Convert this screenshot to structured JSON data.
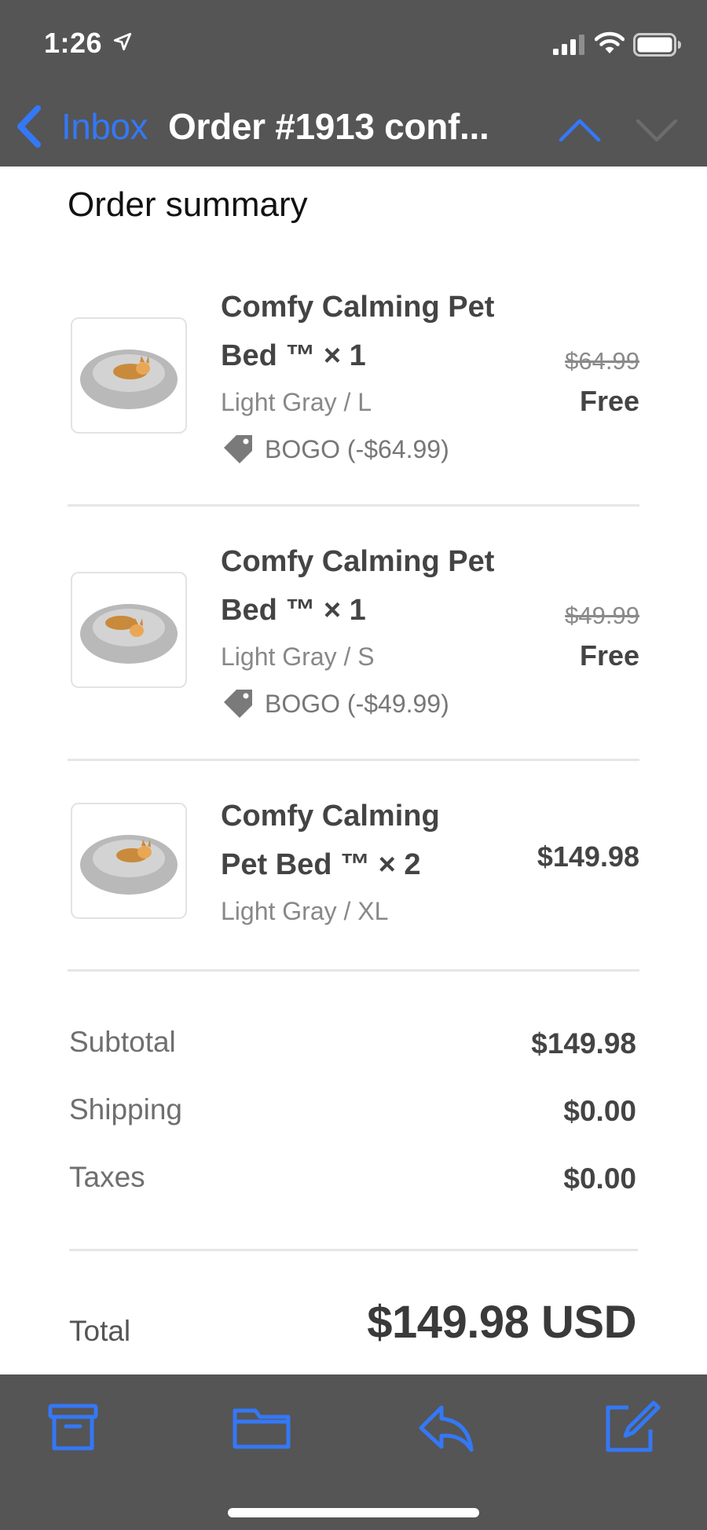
{
  "status_bar": {
    "time": "1:26"
  },
  "nav": {
    "back_label": "Inbox",
    "title": "Order #1913 conf..."
  },
  "content": {
    "section_title": "Order summary",
    "items": [
      {
        "name": "Comfy Calming Pet Bed ™ × 1",
        "variant": "Light Gray / L",
        "discount": "BOGO (-$64.99)",
        "original_price": "$64.99",
        "price": "Free"
      },
      {
        "name": "Comfy Calming Pet Bed ™ × 1",
        "variant": "Light Gray / S",
        "discount": "BOGO (-$49.99)",
        "original_price": "$49.99",
        "price": "Free"
      },
      {
        "name": "Comfy Calming Pet Bed ™ × 2",
        "variant": "Light Gray / XL",
        "price": "$149.98"
      }
    ],
    "summary": {
      "subtotal_label": "Subtotal",
      "subtotal_value": "$149.98",
      "shipping_label": "Shipping",
      "shipping_value": "$0.00",
      "taxes_label": "Taxes",
      "taxes_value": "$0.00",
      "total_label": "Total",
      "total_value": "$149.98 USD"
    }
  },
  "toolbar": {
    "buttons": [
      "archive-icon",
      "folder-icon",
      "reply-icon",
      "compose-icon"
    ]
  },
  "colors": {
    "accent": "#3478f6",
    "bar_background": "#555555",
    "text_dark": "#444444",
    "text_muted": "#888888"
  }
}
